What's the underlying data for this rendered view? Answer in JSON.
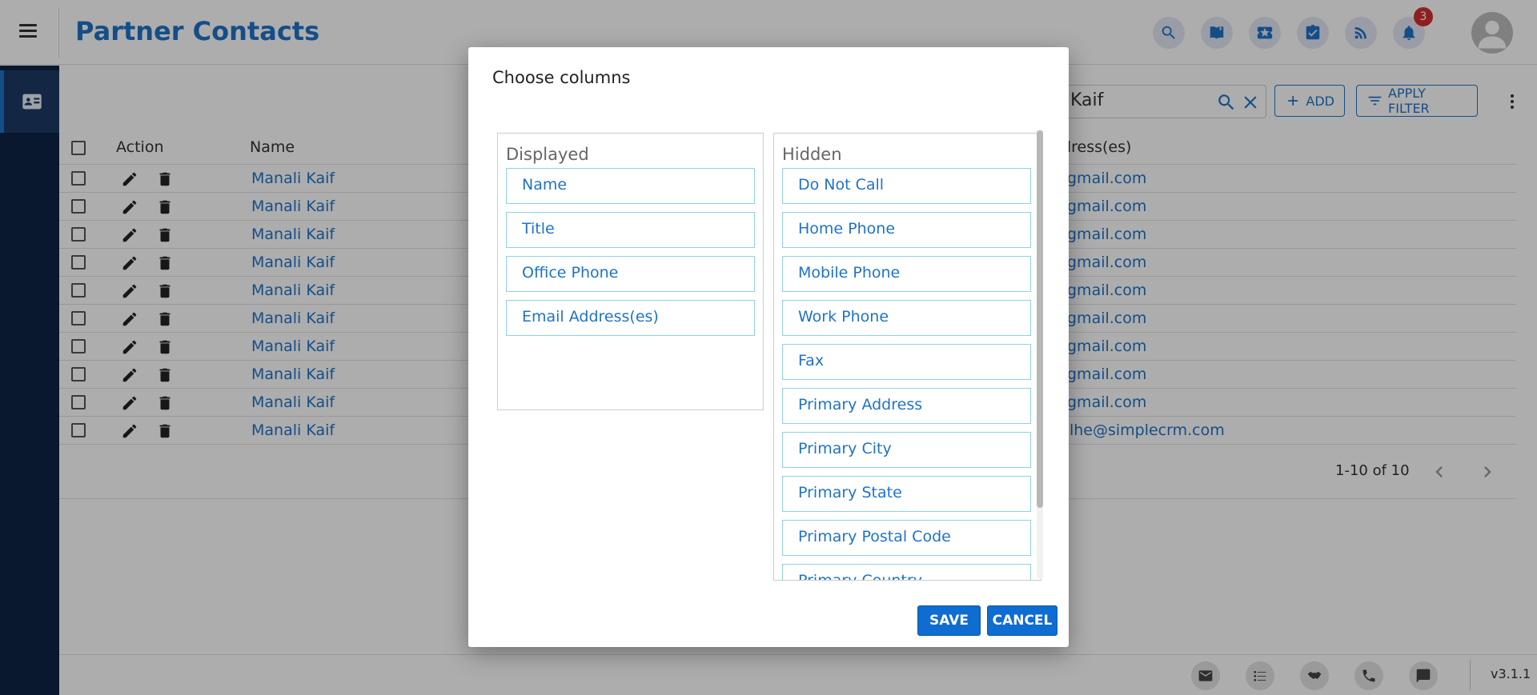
{
  "header": {
    "title": "Partner Contacts",
    "notification_count": "3",
    "icons": [
      "search-icon",
      "book-icon",
      "ticket-icon",
      "tasks-icon",
      "rss-icon",
      "bell-icon"
    ]
  },
  "toolbar": {
    "search_value": "Kaif",
    "add_label": "ADD",
    "filter_label": "APPLY FILTER"
  },
  "table": {
    "columns": {
      "action": "Action",
      "name": "Name",
      "email": "ddress(es)"
    },
    "rows": [
      {
        "name": "Manali Kaif",
        "email": "@gmail.com"
      },
      {
        "name": "Manali Kaif",
        "email": "@gmail.com"
      },
      {
        "name": "Manali Kaif",
        "email": "@gmail.com"
      },
      {
        "name": "Manali Kaif",
        "email": "@gmail.com"
      },
      {
        "name": "Manali Kaif",
        "email": "@gmail.com"
      },
      {
        "name": "Manali Kaif",
        "email": "@gmail.com"
      },
      {
        "name": "Manali Kaif",
        "email": "@gmail.com"
      },
      {
        "name": "Manali Kaif",
        "email": "@gmail.com"
      },
      {
        "name": "Manali Kaif",
        "email": "@gmail.com"
      },
      {
        "name": "Manali Kaif",
        "email": "kolhe@simplecrm.com"
      }
    ]
  },
  "pagination": {
    "range": "1-10 of 10"
  },
  "footer": {
    "version": "v3.1.1"
  },
  "modal": {
    "title": "Choose columns",
    "displayed_label": "Displayed",
    "hidden_label": "Hidden",
    "displayed": [
      "Name",
      "Title",
      "Office Phone",
      "Email Address(es)"
    ],
    "hidden": [
      "Do Not Call",
      "Home Phone",
      "Mobile Phone",
      "Work Phone",
      "Fax",
      "Primary Address",
      "Primary City",
      "Primary State",
      "Primary Postal Code",
      "Primary Country"
    ],
    "save_label": "SAVE",
    "cancel_label": "CANCEL"
  },
  "colors": {
    "accent": "#1f73c8",
    "sidebar": "#0e2446",
    "badge": "#d32f2f",
    "modal_button": "#0f6cd0"
  }
}
